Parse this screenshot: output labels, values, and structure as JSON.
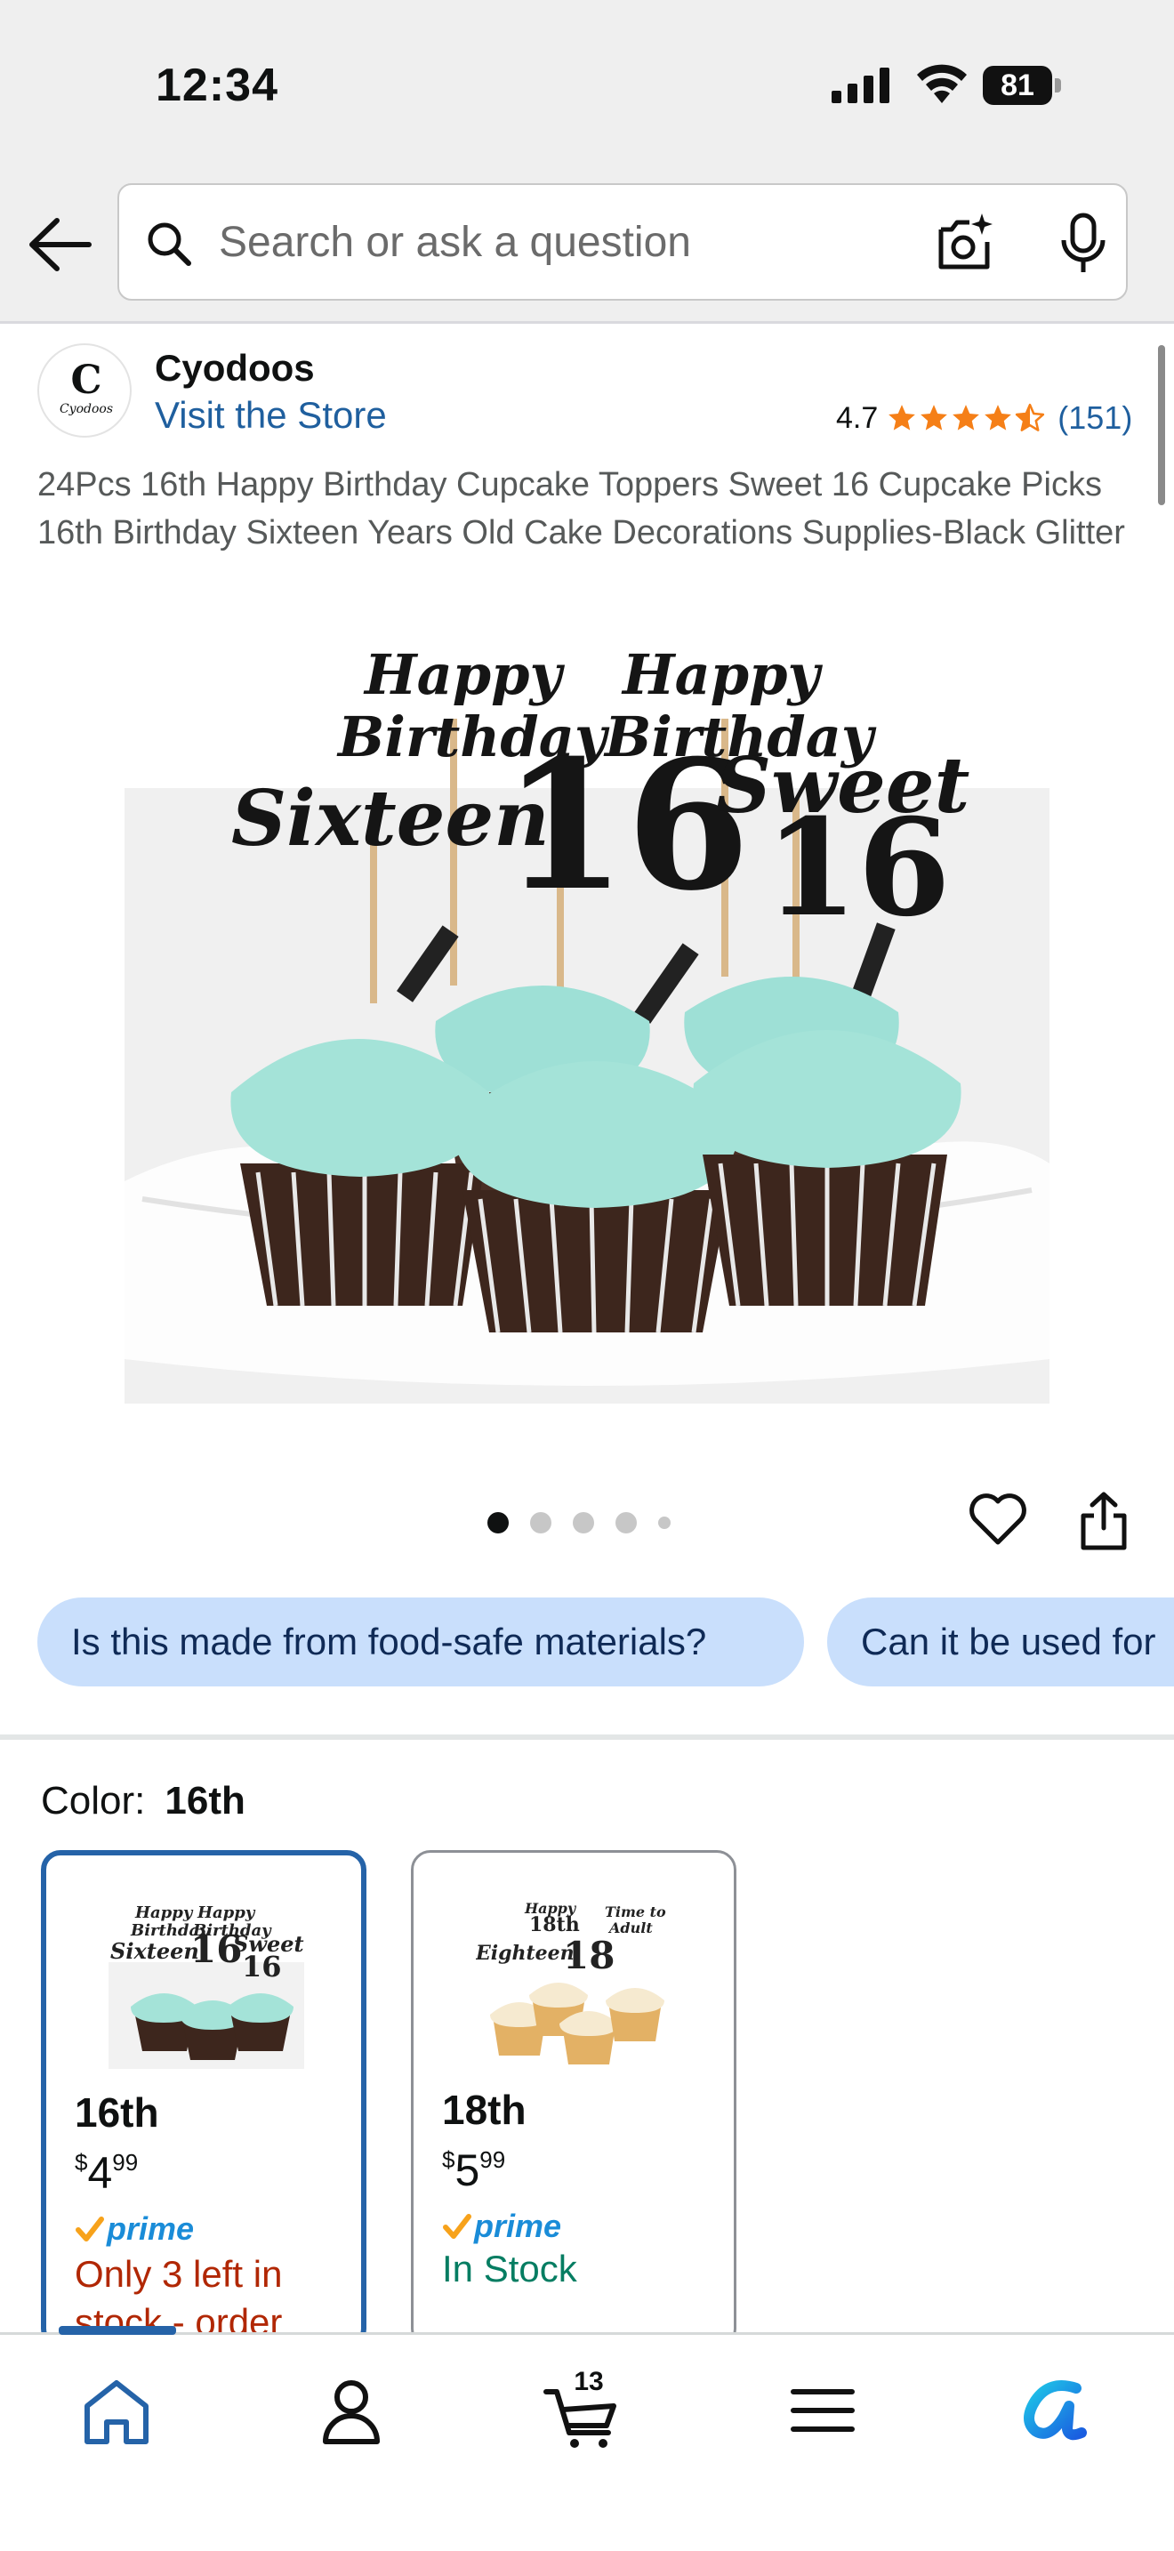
{
  "status_bar": {
    "time": "12:34",
    "battery": "81"
  },
  "search": {
    "placeholder": "Search or ask a question"
  },
  "store": {
    "logo_letter": "C",
    "logo_text": "Cyodoos",
    "name": "Cyodoos",
    "visit_link": "Visit the Store",
    "rating": "4.7",
    "stars": 4.5,
    "rating_count": "(151)"
  },
  "product": {
    "title": "24Pcs 16th Happy Birthday Cupcake Toppers Sweet 16 Cupcake Picks 16th Birthday Sixteen Years Old Cake Decorations Supplies-Black Glitter",
    "image_count": 5,
    "active_image": 0
  },
  "questions": [
    {
      "label": "Is this made from food-safe materials?"
    },
    {
      "label": "Can it be used for"
    }
  ],
  "variation": {
    "label": "Color:",
    "selected": "16th",
    "options": [
      {
        "name": "16th",
        "price_symbol": "$",
        "price_whole": "4",
        "price_cents": "99",
        "prime": "prime",
        "stock": "Only 3 left in stock - order",
        "stock_status": "low"
      },
      {
        "name": "18th",
        "price_symbol": "$",
        "price_whole": "5",
        "price_cents": "99",
        "prime": "prime",
        "stock": "In Stock",
        "stock_status": "in"
      }
    ]
  },
  "nav": {
    "cart_count": "13",
    "items": [
      "home-icon",
      "account-icon",
      "cart-icon",
      "menu-icon",
      "rufus-icon"
    ]
  },
  "colors": {
    "link": "#1f5f9e",
    "star": "#f57f17",
    "chip": "#c9dffc",
    "selected_border": "#2563a8",
    "stock_low": "#b12704",
    "stock_in": "#067d62",
    "prime": "#1a8cd8"
  }
}
